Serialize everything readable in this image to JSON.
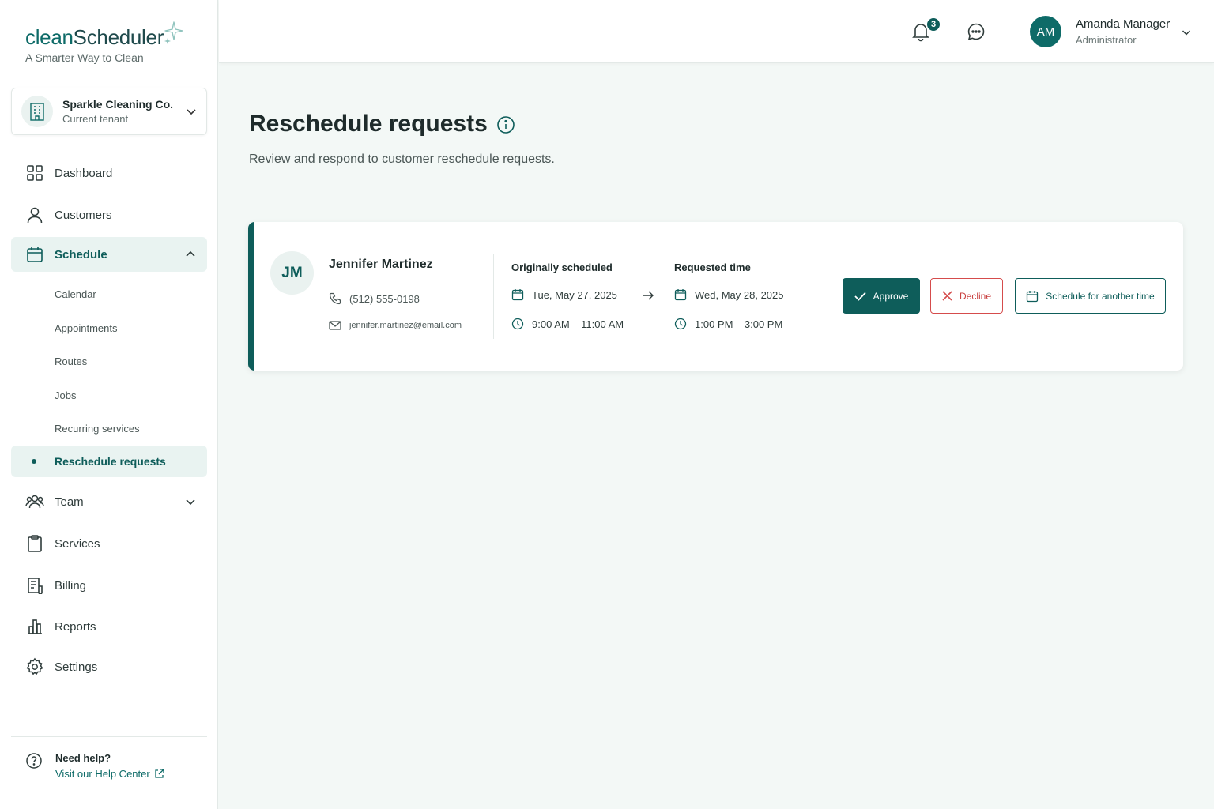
{
  "brand": {
    "name_part1": "clean",
    "name_part2": "Scheduler",
    "tagline": "A Smarter Way to Clean"
  },
  "tenant": {
    "name": "Sparkle Cleaning Co.",
    "subtitle": "Current tenant"
  },
  "nav": {
    "dashboard": "Dashboard",
    "customers": "Customers",
    "schedule": "Schedule",
    "schedule_sub": {
      "calendar": "Calendar",
      "appointments": "Appointments",
      "routes": "Routes",
      "jobs": "Jobs",
      "recurring": "Recurring services",
      "reschedule": "Reschedule requests"
    },
    "team": "Team",
    "services": "Services",
    "billing": "Billing",
    "reports": "Reports",
    "settings": "Settings"
  },
  "help": {
    "title": "Need help?",
    "link": "Visit our Help Center"
  },
  "header": {
    "notification_count": "3",
    "user_initials": "AM",
    "user_name": "Amanda Manager",
    "user_role": "Administrator"
  },
  "page": {
    "title": "Reschedule requests",
    "subtitle": "Review and respond to customer reschedule requests."
  },
  "request": {
    "initials": "JM",
    "name": "Jennifer Martinez",
    "phone": "(512) 555-0198",
    "email": "jennifer.martinez@email.com",
    "original_label": "Originally scheduled",
    "original_date": "Tue, May 27, 2025",
    "original_time": "9:00 AM – 11:00 AM",
    "requested_label": "Requested time",
    "requested_date": "Wed, May 28, 2025",
    "requested_time": "1:00 PM – 3:00 PM"
  },
  "actions": {
    "approve": "Approve",
    "decline": "Decline",
    "other_time": "Schedule for another time"
  },
  "colors": {
    "brand": "#0e5d5a",
    "accent_bg": "#e9f3f1",
    "danger": "#d54c4c",
    "page_bg": "#f3f8f6"
  }
}
